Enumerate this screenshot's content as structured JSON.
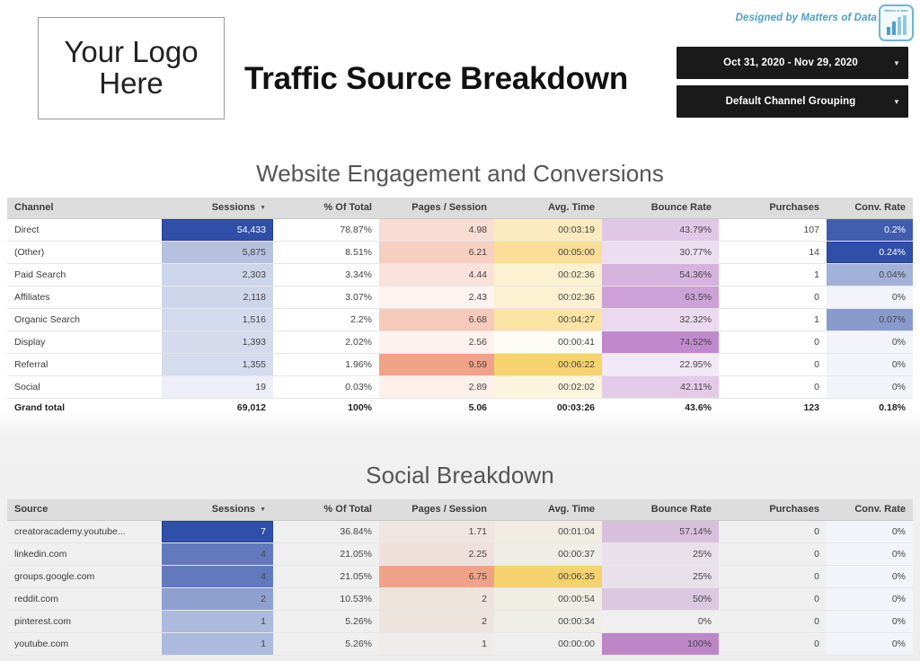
{
  "header": {
    "logo_line1": "Your Logo",
    "logo_line2": "Here",
    "title": "Traffic Source Breakdown",
    "credit": "Designed by Matters of Data",
    "brand_logo_text": "Matters of Data",
    "date_range": "Oct 31, 2020 - Nov 29, 2020",
    "channel_grouping": "Default Channel Grouping",
    "caret": "▼"
  },
  "sections": {
    "engagement_title": "Website Engagement and Conversions",
    "social_title": "Social Breakdown"
  },
  "colors": {
    "accent_blue": "#2f4fa8",
    "credit_blue": "#4e9ec9",
    "header_grey": "#dcdcdc",
    "dark_control": "#1a1a1a"
  },
  "engagement_table": {
    "sort_caret": "▼",
    "columns": [
      "Channel",
      "Sessions",
      "% Of Total",
      "Pages / Session",
      "Avg. Time",
      "Bounce Rate",
      "Purchases",
      "Conv. Rate"
    ],
    "sorted_column": "Sessions",
    "rows": [
      {
        "channel": "Direct",
        "sessions": "54,433",
        "pct": "78.87%",
        "pages": "4.98",
        "time": "00:03:19",
        "bounce": "43.79%",
        "purchases": "107",
        "conv": "0.2%"
      },
      {
        "channel": "(Other)",
        "sessions": "5,875",
        "pct": "8.51%",
        "pages": "6.21",
        "time": "00:05:00",
        "bounce": "30.77%",
        "purchases": "14",
        "conv": "0.24%"
      },
      {
        "channel": "Paid Search",
        "sessions": "2,303",
        "pct": "3.34%",
        "pages": "4.44",
        "time": "00:02:36",
        "bounce": "54.36%",
        "purchases": "1",
        "conv": "0.04%"
      },
      {
        "channel": "Affiliates",
        "sessions": "2,118",
        "pct": "3.07%",
        "pages": "2.43",
        "time": "00:02:36",
        "bounce": "63.5%",
        "purchases": "0",
        "conv": "0%"
      },
      {
        "channel": "Organic Search",
        "sessions": "1,516",
        "pct": "2.2%",
        "pages": "6.68",
        "time": "00:04:27",
        "bounce": "32.32%",
        "purchases": "1",
        "conv": "0.07%"
      },
      {
        "channel": "Display",
        "sessions": "1,393",
        "pct": "2.02%",
        "pages": "2.56",
        "time": "00:00:41",
        "bounce": "74.52%",
        "purchases": "0",
        "conv": "0%"
      },
      {
        "channel": "Referral",
        "sessions": "1,355",
        "pct": "1.96%",
        "pages": "9.59",
        "time": "00:06:22",
        "bounce": "22.95%",
        "purchases": "0",
        "conv": "0%"
      },
      {
        "channel": "Social",
        "sessions": "19",
        "pct": "0.03%",
        "pages": "2.89",
        "time": "00:02:02",
        "bounce": "42.11%",
        "purchases": "0",
        "conv": "0%"
      }
    ],
    "grand_total": {
      "channel": "Grand total",
      "sessions": "69,012",
      "pct": "100%",
      "pages": "5.06",
      "time": "00:03:26",
      "bounce": "43.6%",
      "purchases": "123",
      "conv": "0.18%"
    }
  },
  "social_table": {
    "sort_caret": "▼",
    "columns": [
      "Source",
      "Sessions",
      "% Of Total",
      "Pages / Session",
      "Avg. Time",
      "Bounce Rate",
      "Purchases",
      "Conv. Rate"
    ],
    "sorted_column": "Sessions",
    "rows": [
      {
        "source": "creatoracademy.youtube...",
        "sessions": "7",
        "pct": "36.84%",
        "pages": "1.71",
        "time": "00:01:04",
        "bounce": "57.14%",
        "purchases": "0",
        "conv": "0%"
      },
      {
        "source": "linkedin.com",
        "sessions": "4",
        "pct": "21.05%",
        "pages": "2.25",
        "time": "00:00:37",
        "bounce": "25%",
        "purchases": "0",
        "conv": "0%"
      },
      {
        "source": "groups.google.com",
        "sessions": "4",
        "pct": "21.05%",
        "pages": "6.75",
        "time": "00:06:35",
        "bounce": "25%",
        "purchases": "0",
        "conv": "0%"
      },
      {
        "source": "reddit.com",
        "sessions": "2",
        "pct": "10.53%",
        "pages": "2",
        "time": "00:00:54",
        "bounce": "50%",
        "purchases": "0",
        "conv": "0%"
      },
      {
        "source": "pinterest.com",
        "sessions": "1",
        "pct": "5.26%",
        "pages": "2",
        "time": "00:00:34",
        "bounce": "0%",
        "purchases": "0",
        "conv": "0%"
      },
      {
        "source": "youtube.com",
        "sessions": "1",
        "pct": "5.26%",
        "pages": "1",
        "time": "00:00:00",
        "bounce": "100%",
        "purchases": "0",
        "conv": "0%"
      }
    ]
  },
  "chart_data": {
    "type": "table",
    "title": "Traffic Source Breakdown",
    "tables": [
      {
        "name": "Website Engagement and Conversions",
        "columns": [
          "Channel",
          "Sessions",
          "% Of Total",
          "Pages / Session",
          "Avg. Time",
          "Bounce Rate",
          "Purchases",
          "Conv. Rate"
        ],
        "categories": [
          "Direct",
          "(Other)",
          "Paid Search",
          "Affiliates",
          "Organic Search",
          "Display",
          "Referral",
          "Social"
        ],
        "series": [
          {
            "name": "Sessions",
            "values": [
              54433,
              5875,
              2303,
              2118,
              1516,
              1393,
              1355,
              19
            ]
          },
          {
            "name": "% Of Total",
            "values": [
              78.87,
              8.51,
              3.34,
              3.07,
              2.2,
              2.02,
              1.96,
              0.03
            ]
          },
          {
            "name": "Pages / Session",
            "values": [
              4.98,
              6.21,
              4.44,
              2.43,
              6.68,
              2.56,
              9.59,
              2.89
            ]
          },
          {
            "name": "Avg. Time (sec)",
            "values": [
              199,
              300,
              156,
              156,
              267,
              41,
              382,
              122
            ]
          },
          {
            "name": "Bounce Rate",
            "values": [
              43.79,
              30.77,
              54.36,
              63.5,
              32.32,
              74.52,
              22.95,
              42.11
            ]
          },
          {
            "name": "Purchases",
            "values": [
              107,
              14,
              1,
              0,
              1,
              0,
              0,
              0
            ]
          },
          {
            "name": "Conv. Rate",
            "values": [
              0.2,
              0.24,
              0.04,
              0,
              0.07,
              0,
              0,
              0
            ]
          }
        ],
        "totals": {
          "Sessions": 69012,
          "% Of Total": 100,
          "Pages / Session": 5.06,
          "Avg. Time": "00:03:26",
          "Bounce Rate": 43.6,
          "Purchases": 123,
          "Conv. Rate": 0.18
        }
      },
      {
        "name": "Social Breakdown",
        "columns": [
          "Source",
          "Sessions",
          "% Of Total",
          "Pages / Session",
          "Avg. Time",
          "Bounce Rate",
          "Purchases",
          "Conv. Rate"
        ],
        "categories": [
          "creatoracademy.youtube...",
          "linkedin.com",
          "groups.google.com",
          "reddit.com",
          "pinterest.com",
          "youtube.com"
        ],
        "series": [
          {
            "name": "Sessions",
            "values": [
              7,
              4,
              4,
              2,
              1,
              1
            ]
          },
          {
            "name": "% Of Total",
            "values": [
              36.84,
              21.05,
              21.05,
              10.53,
              5.26,
              5.26
            ]
          },
          {
            "name": "Pages / Session",
            "values": [
              1.71,
              2.25,
              6.75,
              2,
              2,
              1
            ]
          },
          {
            "name": "Avg. Time (sec)",
            "values": [
              64,
              37,
              395,
              54,
              34,
              0
            ]
          },
          {
            "name": "Bounce Rate",
            "values": [
              57.14,
              25,
              25,
              50,
              0,
              100
            ]
          },
          {
            "name": "Purchases",
            "values": [
              0,
              0,
              0,
              0,
              0,
              0
            ]
          },
          {
            "name": "Conv. Rate",
            "values": [
              0,
              0,
              0,
              0,
              0,
              0
            ]
          }
        ]
      }
    ]
  }
}
